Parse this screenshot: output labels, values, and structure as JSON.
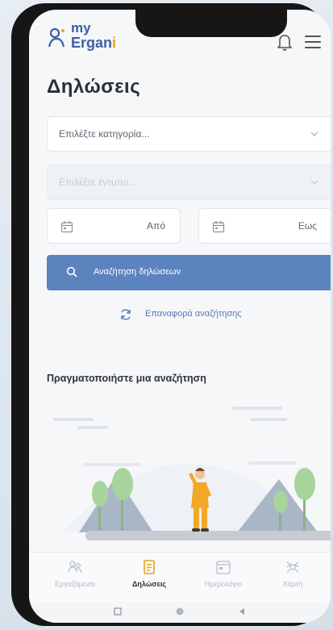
{
  "app": {
    "logo_my": "my",
    "logo_ergani_main": "Ergan",
    "logo_ergani_accent": "i"
  },
  "page_title": "Δηλώσεις",
  "filters": {
    "category_placeholder": "Επιλέξτε κατηγορία...",
    "type_placeholder": "Επιλέξτε έντυπο...",
    "date_from": "Από",
    "date_to": "Εως"
  },
  "actions": {
    "search_label": "Αναζήτηση δηλώσεων",
    "reset_label": "Επαναφορά αναζήτησης"
  },
  "empty_state": {
    "prompt": "Πραγματοποιήστε μια αναζήτηση"
  },
  "tabs": [
    {
      "label": "Εργαζόμενοι",
      "icon": "people-icon",
      "active": false
    },
    {
      "label": "Δηλώσεις",
      "icon": "declarations-icon",
      "active": true
    },
    {
      "label": "Ημερολόγιο",
      "icon": "calendar-icon",
      "active": false
    },
    {
      "label": "Χάρτη",
      "icon": "map-icon",
      "active": false
    }
  ],
  "colors": {
    "primary": "#5b84bf",
    "accent_active": "#e8a21a",
    "logo_blue": "#3b5fa8"
  }
}
